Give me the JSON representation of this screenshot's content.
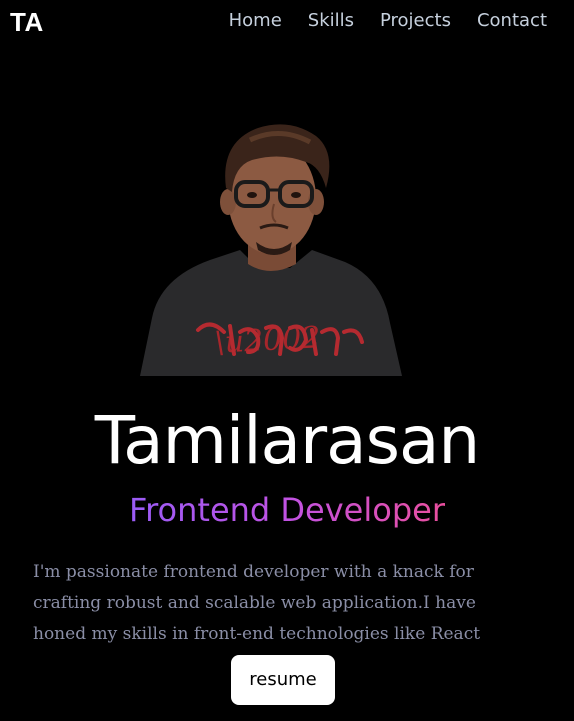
{
  "header": {
    "logo_text": "TA",
    "nav": [
      {
        "label": "Home"
      },
      {
        "label": "Skills"
      },
      {
        "label": "Projects"
      },
      {
        "label": "Contact"
      }
    ]
  },
  "hero": {
    "name": "Tamilarasan",
    "role": "Frontend Developer",
    "bio": "I'm passionate frontend developer with a knack for crafting robust and scalable web application.I have honed my skills in front-end technologies like React",
    "resume_label": "resume",
    "role_gradient": [
      "#9a5cf6",
      "#c152e3",
      "#e94f9e"
    ]
  },
  "colors": {
    "background": "#000000",
    "nav_text": "#c6d0dd",
    "bio_text": "#8a8ea6",
    "button_bg": "#ffffff"
  }
}
